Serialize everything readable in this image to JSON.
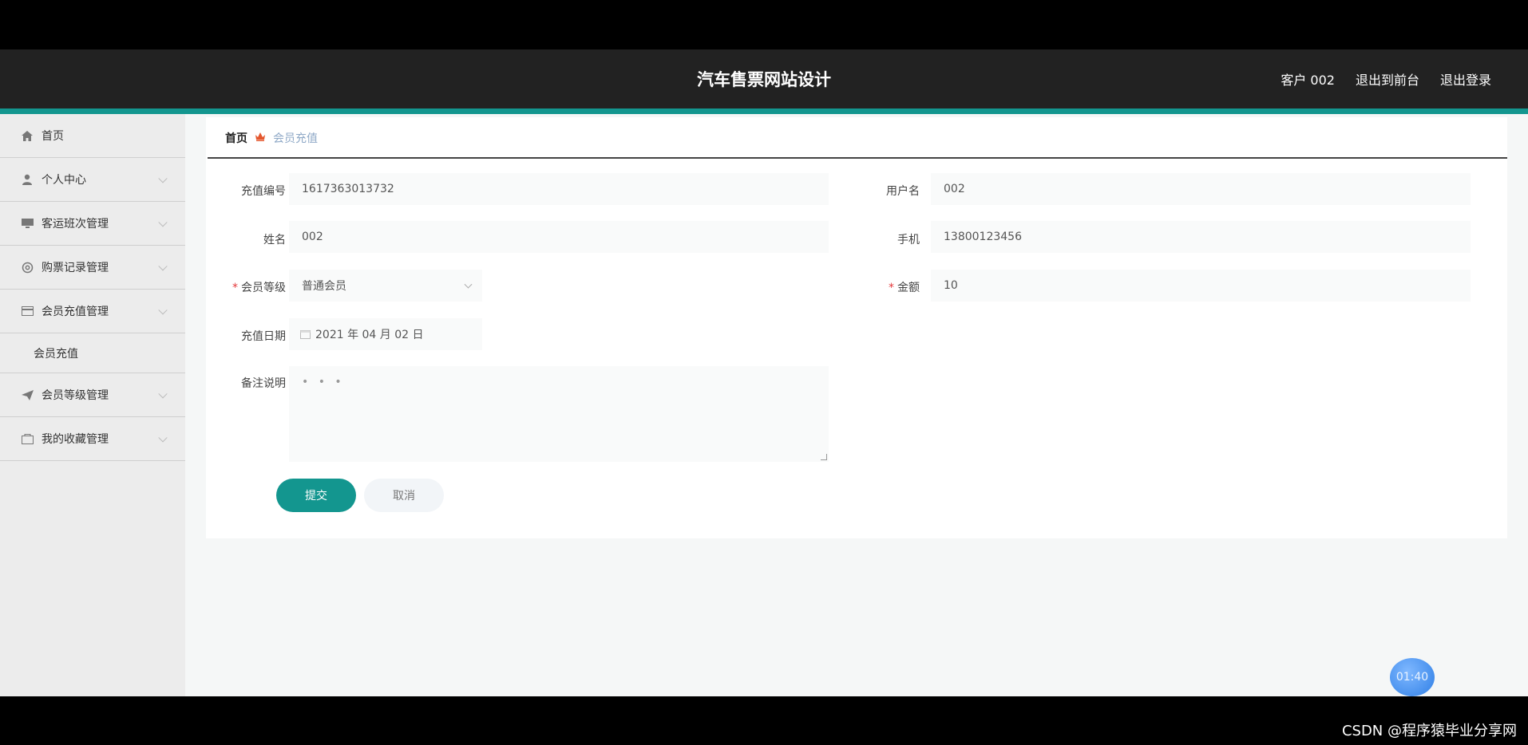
{
  "header": {
    "title": "汽车售票网站设计",
    "links": [
      "客户 002",
      "退出到前台",
      "退出登录"
    ]
  },
  "sidebar": {
    "items": [
      {
        "label": "首页",
        "icon": "home-icon"
      },
      {
        "label": "个人中心",
        "icon": "user-icon"
      },
      {
        "label": "客运班次管理",
        "icon": "monitor-icon"
      },
      {
        "label": "购票记录管理",
        "icon": "gear-icon"
      },
      {
        "label": "会员充值管理",
        "icon": "card-icon"
      },
      {
        "label": "会员充值",
        "icon": ""
      },
      {
        "label": "会员等级管理",
        "icon": "send-icon"
      },
      {
        "label": "我的收藏管理",
        "icon": "folder-icon"
      }
    ]
  },
  "breadcrumb": {
    "home": "首页",
    "current": "会员充值"
  },
  "form": {
    "recharge_no_label": "充值编号",
    "recharge_no": "1617363013732",
    "username_label": "用户名",
    "username": "002",
    "name_label": "姓名",
    "name": "002",
    "phone_label": "手机",
    "phone": "13800123456",
    "level_label": "会员等级",
    "level": "普通会员",
    "amount_label": "金额",
    "amount": "10",
    "date_label": "充值日期",
    "date": "2021 年 04 月 02 日",
    "remark_label": "备注说明",
    "remark": "• • •",
    "required_mark": "*"
  },
  "buttons": {
    "submit": "提交",
    "cancel": "取消"
  },
  "timer": "01:40",
  "watermark": "CSDN @程序猿毕业分享网",
  "colors": {
    "accent": "#13968f",
    "header_bg": "#222222",
    "sidebar_bg": "#ececec"
  }
}
